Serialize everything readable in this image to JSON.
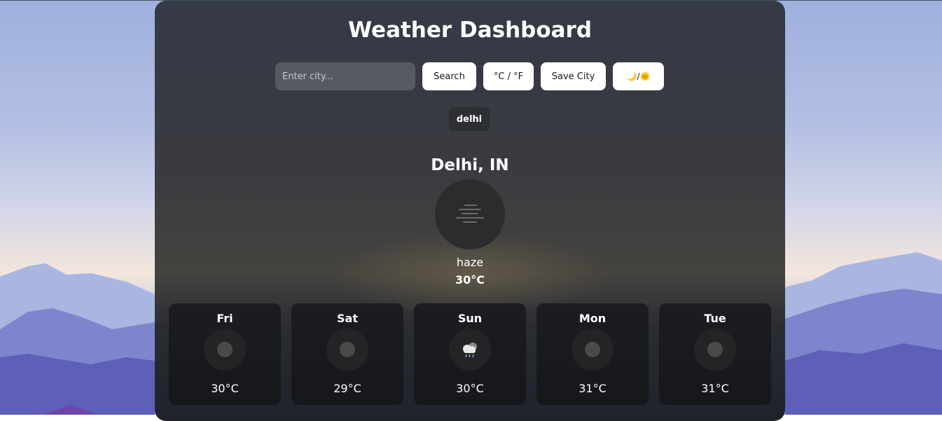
{
  "header": {
    "title": "Weather Dashboard"
  },
  "search": {
    "placeholder": "Enter city...",
    "value": "",
    "search_label": "Search",
    "unit_label": "°C / °F",
    "save_label": "Save City",
    "theme_label": "🌙/🌞"
  },
  "saved_cities": [
    "delhi"
  ],
  "current": {
    "city": "Delhi, IN",
    "description": "haze",
    "temperature": "30°C",
    "icon": "haze-icon"
  },
  "forecast": [
    {
      "day": "Fri",
      "temp": "30°C",
      "icon": "placeholder-dot-icon"
    },
    {
      "day": "Sat",
      "temp": "29°C",
      "icon": "placeholder-dot-icon"
    },
    {
      "day": "Sun",
      "temp": "30°C",
      "icon": "rain-cloud-icon"
    },
    {
      "day": "Mon",
      "temp": "31°C",
      "icon": "placeholder-dot-icon"
    },
    {
      "day": "Tue",
      "temp": "31°C",
      "icon": "placeholder-dot-icon"
    }
  ],
  "colors": {
    "card_bg": "#353a47",
    "button_bg": "#ffffff",
    "input_bg": "#575a63",
    "forecast_card_bg": "#1c1d20"
  }
}
